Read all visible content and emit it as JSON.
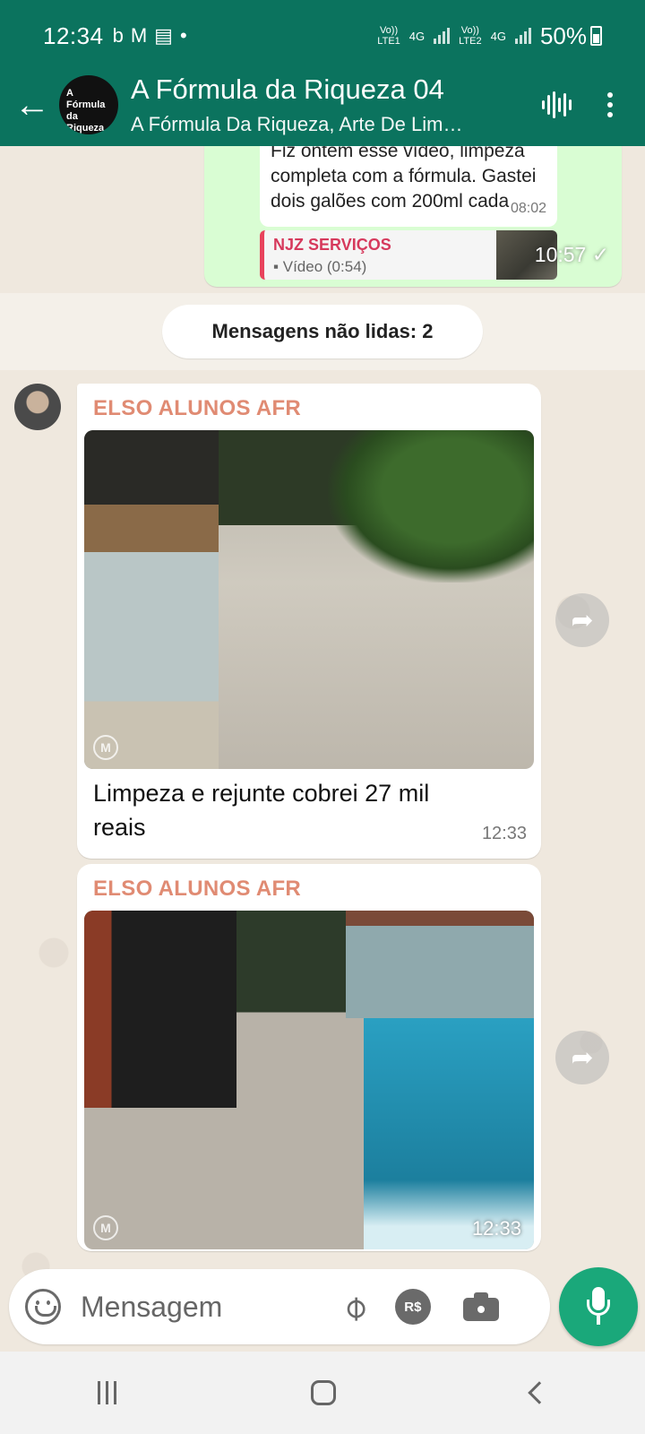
{
  "status_bar": {
    "time": "12:34",
    "notif_icons": [
      "b",
      "M",
      "▤",
      "•"
    ],
    "sim1_label_top": "Vo))",
    "sim1_label_bottom": "LTE1",
    "sim1_net": "4G",
    "sim2_label_top": "Vo))",
    "sim2_label_bottom": "LTE2",
    "sim2_net": "4G",
    "battery": "50%"
  },
  "header": {
    "avatar_text_line1": "A Fórmula da",
    "avatar_text_line2": "Riqueza",
    "title": "A Fórmula da Riqueza 04",
    "subtitle": "A Fórmula Da Riqueza, Arte De Lim…"
  },
  "outgoing": {
    "quoted_text": "Fiz ontem esse vídeo, limpeza completa com a fórmula. Gastei dois galões com 200ml cada",
    "quoted_time": "08:02",
    "reply_name": "NJZ SERVIÇOS",
    "reply_type": "Vídeo (0:54)",
    "time": "10:57 ✓"
  },
  "unread_label": "Mensagens não lidas: 2",
  "messages": [
    {
      "sender": "ELSO ALUNOS AFR",
      "caption_line1": "Limpeza e rejunte cobrei 27 mil",
      "caption_line2": "reais",
      "time": "12:33"
    },
    {
      "sender": "ELSO ALUNOS AFR",
      "time": "12:33"
    }
  ],
  "composer": {
    "placeholder": "Mensagem",
    "pay_label": "R$"
  },
  "colors": {
    "header_bg": "#0b735e",
    "sender_name": "#e08b73",
    "outgoing_bubble": "#d9fdd3",
    "mic_button": "#1aa87a"
  }
}
